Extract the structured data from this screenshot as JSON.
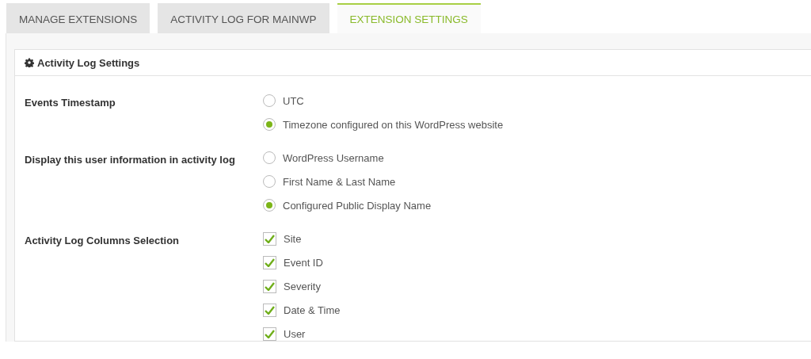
{
  "tabs": [
    {
      "label": "MANAGE EXTENSIONS",
      "selected": false
    },
    {
      "label": "ACTIVITY LOG FOR MAINWP",
      "selected": false
    },
    {
      "label": "EXTENSION SETTINGS",
      "selected": true
    }
  ],
  "panel": {
    "title": "Activity Log Settings",
    "settings": [
      {
        "label": "Events Timestamp",
        "kind": "radio",
        "options": [
          {
            "label": "UTC",
            "selected": false
          },
          {
            "label": "Timezone configured on this WordPress website",
            "selected": true
          }
        ]
      },
      {
        "label": "Display this user information in activity log",
        "kind": "radio",
        "options": [
          {
            "label": "WordPress Username",
            "selected": false
          },
          {
            "label": "First Name & Last Name",
            "selected": false
          },
          {
            "label": "Configured Public Display Name",
            "selected": true
          }
        ]
      },
      {
        "label": "Activity Log Columns Selection",
        "kind": "checkbox",
        "options": [
          {
            "label": "Site",
            "checked": true
          },
          {
            "label": "Event ID",
            "checked": true
          },
          {
            "label": "Severity",
            "checked": true
          },
          {
            "label": "Date & Time",
            "checked": true
          },
          {
            "label": "User",
            "checked": true
          }
        ]
      }
    ]
  }
}
